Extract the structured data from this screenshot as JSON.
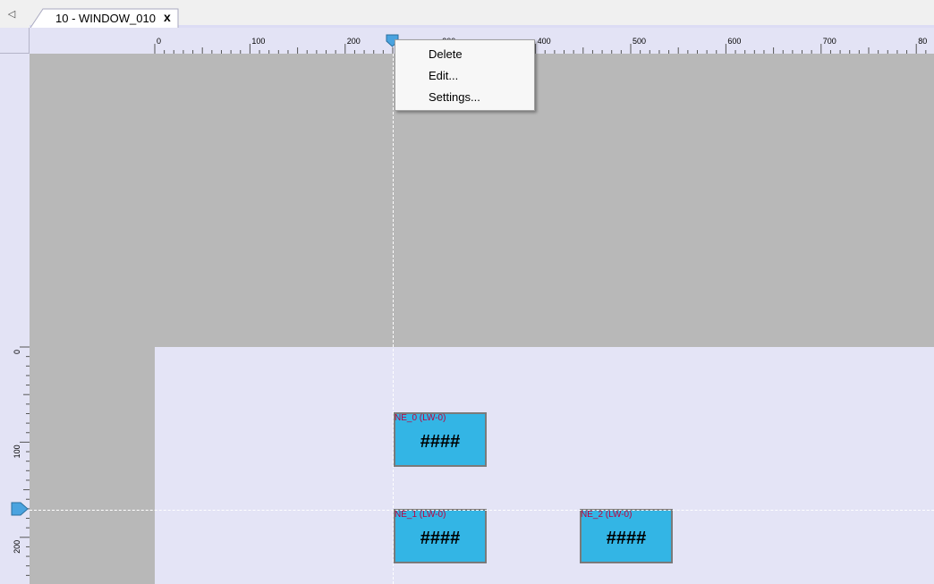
{
  "tabs": {
    "active_title": "10 - WINDOW_010",
    "close_glyph": "x",
    "scroll_left_glyph": "◁"
  },
  "ruler": {
    "horizontal_labels": [
      "0",
      "100",
      "200",
      "300",
      "400",
      "500",
      "600",
      "700",
      "80"
    ],
    "vertical_labels": [
      "0",
      "100",
      "200"
    ]
  },
  "canvas": {
    "background_color": "#b8b8b8",
    "window_color": "#e4e4f6",
    "objects": [
      {
        "label": "NE_0 (LW-0)",
        "value": "####"
      },
      {
        "label": "NE_1 (LW-0)",
        "value": "####"
      },
      {
        "label": "NE_2 (LW-0)",
        "value": "####"
      }
    ]
  },
  "context_menu": {
    "items": [
      "Delete",
      "Edit...",
      "Settings..."
    ]
  },
  "colors": {
    "object_fill": "#33b5e5",
    "object_label": "#c0003c",
    "marker": "#4aa3df"
  }
}
